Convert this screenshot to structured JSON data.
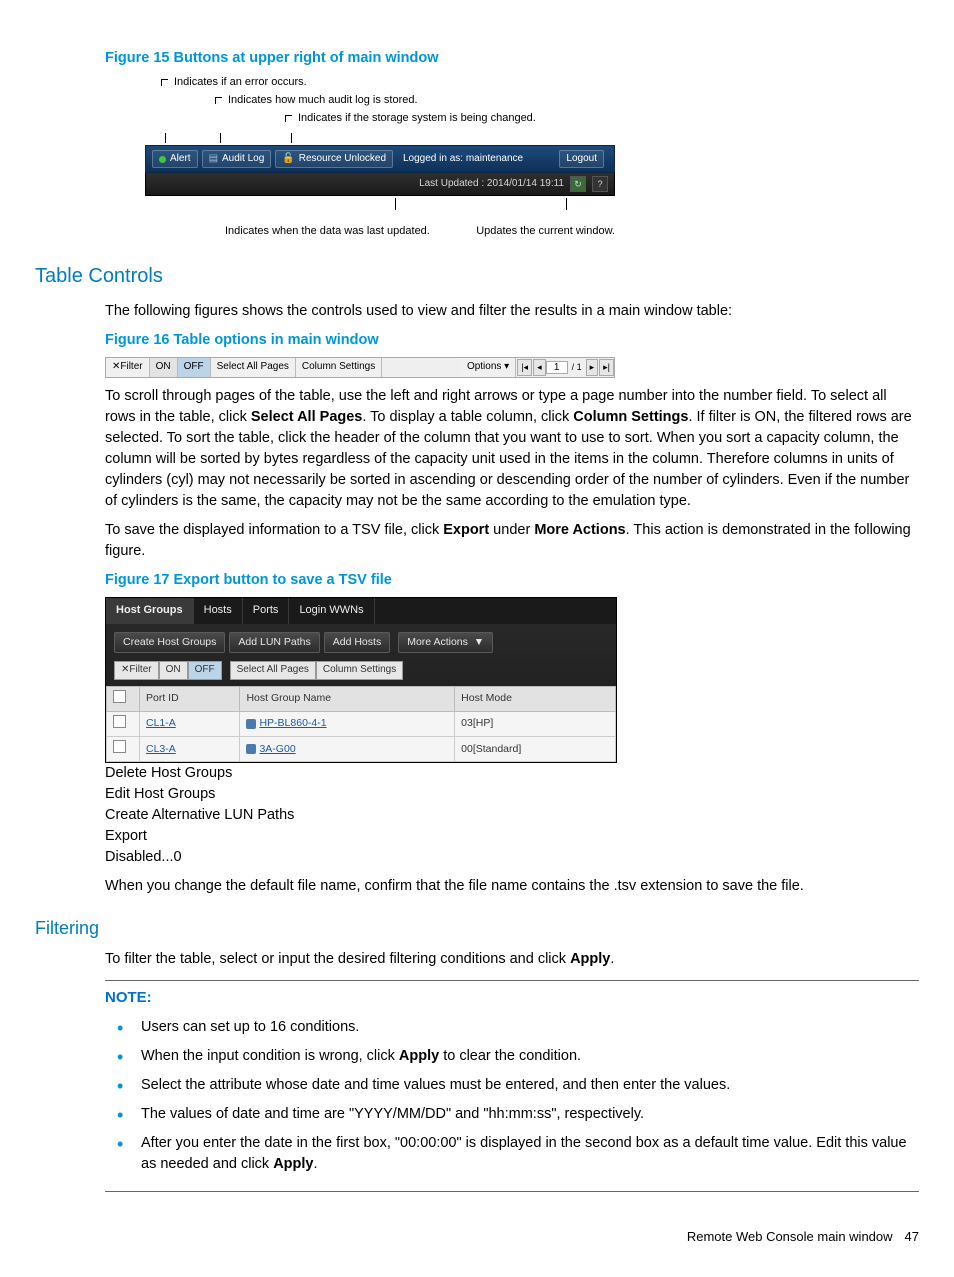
{
  "figures": {
    "f15": {
      "caption": "Figure 15 Buttons at upper right of main window",
      "annot_error": "Indicates if an error occurs.",
      "annot_audit": "Indicates how much audit log is stored.",
      "annot_change": "Indicates if the storage system is being changed.",
      "alert": "Alert",
      "auditlog": "Audit Log",
      "resource": "Resource Unlocked",
      "loggedin": "Logged in as: maintenance",
      "logout": "Logout",
      "lastupdated": "Last Updated : 2014/01/14 19:11",
      "annot_lastupdated": "Indicates when the data was last updated.",
      "annot_refresh": "Updates the current window."
    },
    "f16": {
      "caption": "Figure 16  Table options in main window",
      "filter": "✕Filter",
      "on": "ON",
      "off": "OFF",
      "selectall": "Select All Pages",
      "colsettings": "Column Settings",
      "options": "Options ▾",
      "page": "1",
      "total": "/ 1"
    },
    "f17": {
      "caption": "Figure 17 Export button to save a TSV file",
      "tabs": [
        "Host Groups",
        "Hosts",
        "Ports",
        "Login WWNs"
      ],
      "buttons": {
        "create": "Create Host Groups",
        "add_lun": "Add LUN Paths",
        "add_hosts": "Add Hosts",
        "more": "More Actions"
      },
      "menu": [
        "Delete Host Groups",
        "Edit Host Groups",
        "Create Alternative LUN Paths",
        "Export"
      ],
      "disabled_row": {
        "label": "Disabled...",
        "count": "0"
      },
      "filter": {
        "label": "✕Filter",
        "on": "ON",
        "off": "OFF",
        "selectall": "Select All Pages",
        "colsettings": "Column Settings"
      },
      "headers": [
        "",
        "Port ID",
        "Host Group Name",
        "Host Mode"
      ],
      "rows": [
        {
          "port": "CL1-A",
          "group": "HP-BL860-4-1",
          "mode": "03[HP]"
        },
        {
          "port": "CL3-A",
          "group": "3A-G00",
          "mode": "00[Standard]"
        }
      ]
    }
  },
  "sections": {
    "table_controls_h": "Table Controls",
    "table_controls_p": "The following figures shows the controls used to view and filter the results in a main window table:",
    "scroll_p1a": "To scroll through pages of the table, use the left and right arrows or type a page number into the number field. To select all rows in the table, click ",
    "scroll_b1": "Select All Pages",
    "scroll_p1b": ". To display a table column, click ",
    "scroll_b2": "Column Settings",
    "scroll_p1c": ". If filter is ON, the filtered rows are selected. To sort the table, click the header of the column that you want to use to sort. When you sort a capacity column, the column will be sorted by bytes regardless of the capacity unit used in the items in the column. Therefore columns in units of cylinders (cyl) may not necessarily be sorted in ascending or descending order of the number of cylinders. Even if the number of cylinders is the same, the capacity may not be the same according to the emulation type.",
    "save_p_a": "To save the displayed information to a TSV file, click ",
    "save_b1": "Export",
    "save_p_b": " under ",
    "save_b2": "More Actions",
    "save_p_c": ". This action is demonstrated in the following figure.",
    "confirm_p": "When you change the default file name, confirm that the file name contains the .tsv extension to save the file.",
    "filtering_h": "Filtering",
    "filtering_p_a": "To filter the table, select or input the desired filtering conditions and click ",
    "filtering_b": "Apply",
    "filtering_p_b": ".",
    "note_label": "NOTE:",
    "notes": {
      "n1": "Users can set up to 16 conditions.",
      "n2a": "When the input condition is wrong, click ",
      "n2b": "Apply",
      "n2c": " to clear the condition.",
      "n3": "Select the attribute whose date and time values must be entered, and then enter the values.",
      "n4": "The values of date and time are \"YYYY/MM/DD\" and \"hh:mm:ss\", respectively.",
      "n5a": "After you enter the date in the first box, \"00:00:00\" is displayed in the second box as a default time value. Edit this value as needed and click ",
      "n5b": "Apply",
      "n5c": "."
    }
  },
  "footer": {
    "text": "Remote Web Console main window",
    "page": "47"
  }
}
